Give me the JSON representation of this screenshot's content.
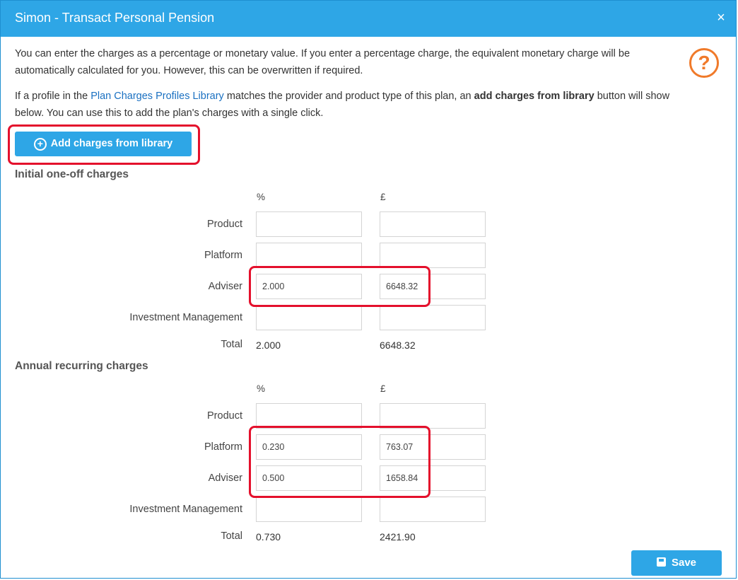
{
  "dialog": {
    "title": "Simon - Transact Personal Pension",
    "close": "×"
  },
  "intro": {
    "line1": "You can enter the charges as a percentage or monetary value. If you enter a percentage charge, the equivalent monetary charge will be",
    "line2": "automatically calculated for you. However, this can be overwritten if required.",
    "p2_pre": "If a profile in the ",
    "p2_link": "Plan Charges Profiles Library",
    "p2_mid": " matches the provider and product type of this plan, an ",
    "p2_bold": "add charges from library",
    "p2_post": " button will show",
    "p2_line2": "below. You can use this to add the plan's charges with a single click."
  },
  "help": "?",
  "add_button": "Add charges from library",
  "initial": {
    "heading": "Initial one-off charges",
    "col_pct": "%",
    "col_gbp": "£",
    "rows": [
      {
        "label": "Product",
        "pct": "",
        "gbp": ""
      },
      {
        "label": "Platform",
        "pct": "",
        "gbp": ""
      },
      {
        "label": "Adviser",
        "pct": "2.000",
        "gbp": "6648.32"
      },
      {
        "label": "Investment Management",
        "pct": "",
        "gbp": ""
      }
    ],
    "total_label": "Total",
    "total_pct": "2.000",
    "total_gbp": "6648.32"
  },
  "annual": {
    "heading": "Annual recurring charges",
    "col_pct": "%",
    "col_gbp": "£",
    "rows": [
      {
        "label": "Product",
        "pct": "",
        "gbp": ""
      },
      {
        "label": "Platform",
        "pct": "0.230",
        "gbp": "763.07"
      },
      {
        "label": "Adviser",
        "pct": "0.500",
        "gbp": "1658.84"
      },
      {
        "label": "Investment Management",
        "pct": "",
        "gbp": ""
      }
    ],
    "total_label": "Total",
    "total_pct": "0.730",
    "total_gbp": "2421.90"
  },
  "save_button": "Save",
  "colors": {
    "header": "#2ea6e6",
    "highlight": "#e4102c",
    "help": "#f07a2a"
  }
}
